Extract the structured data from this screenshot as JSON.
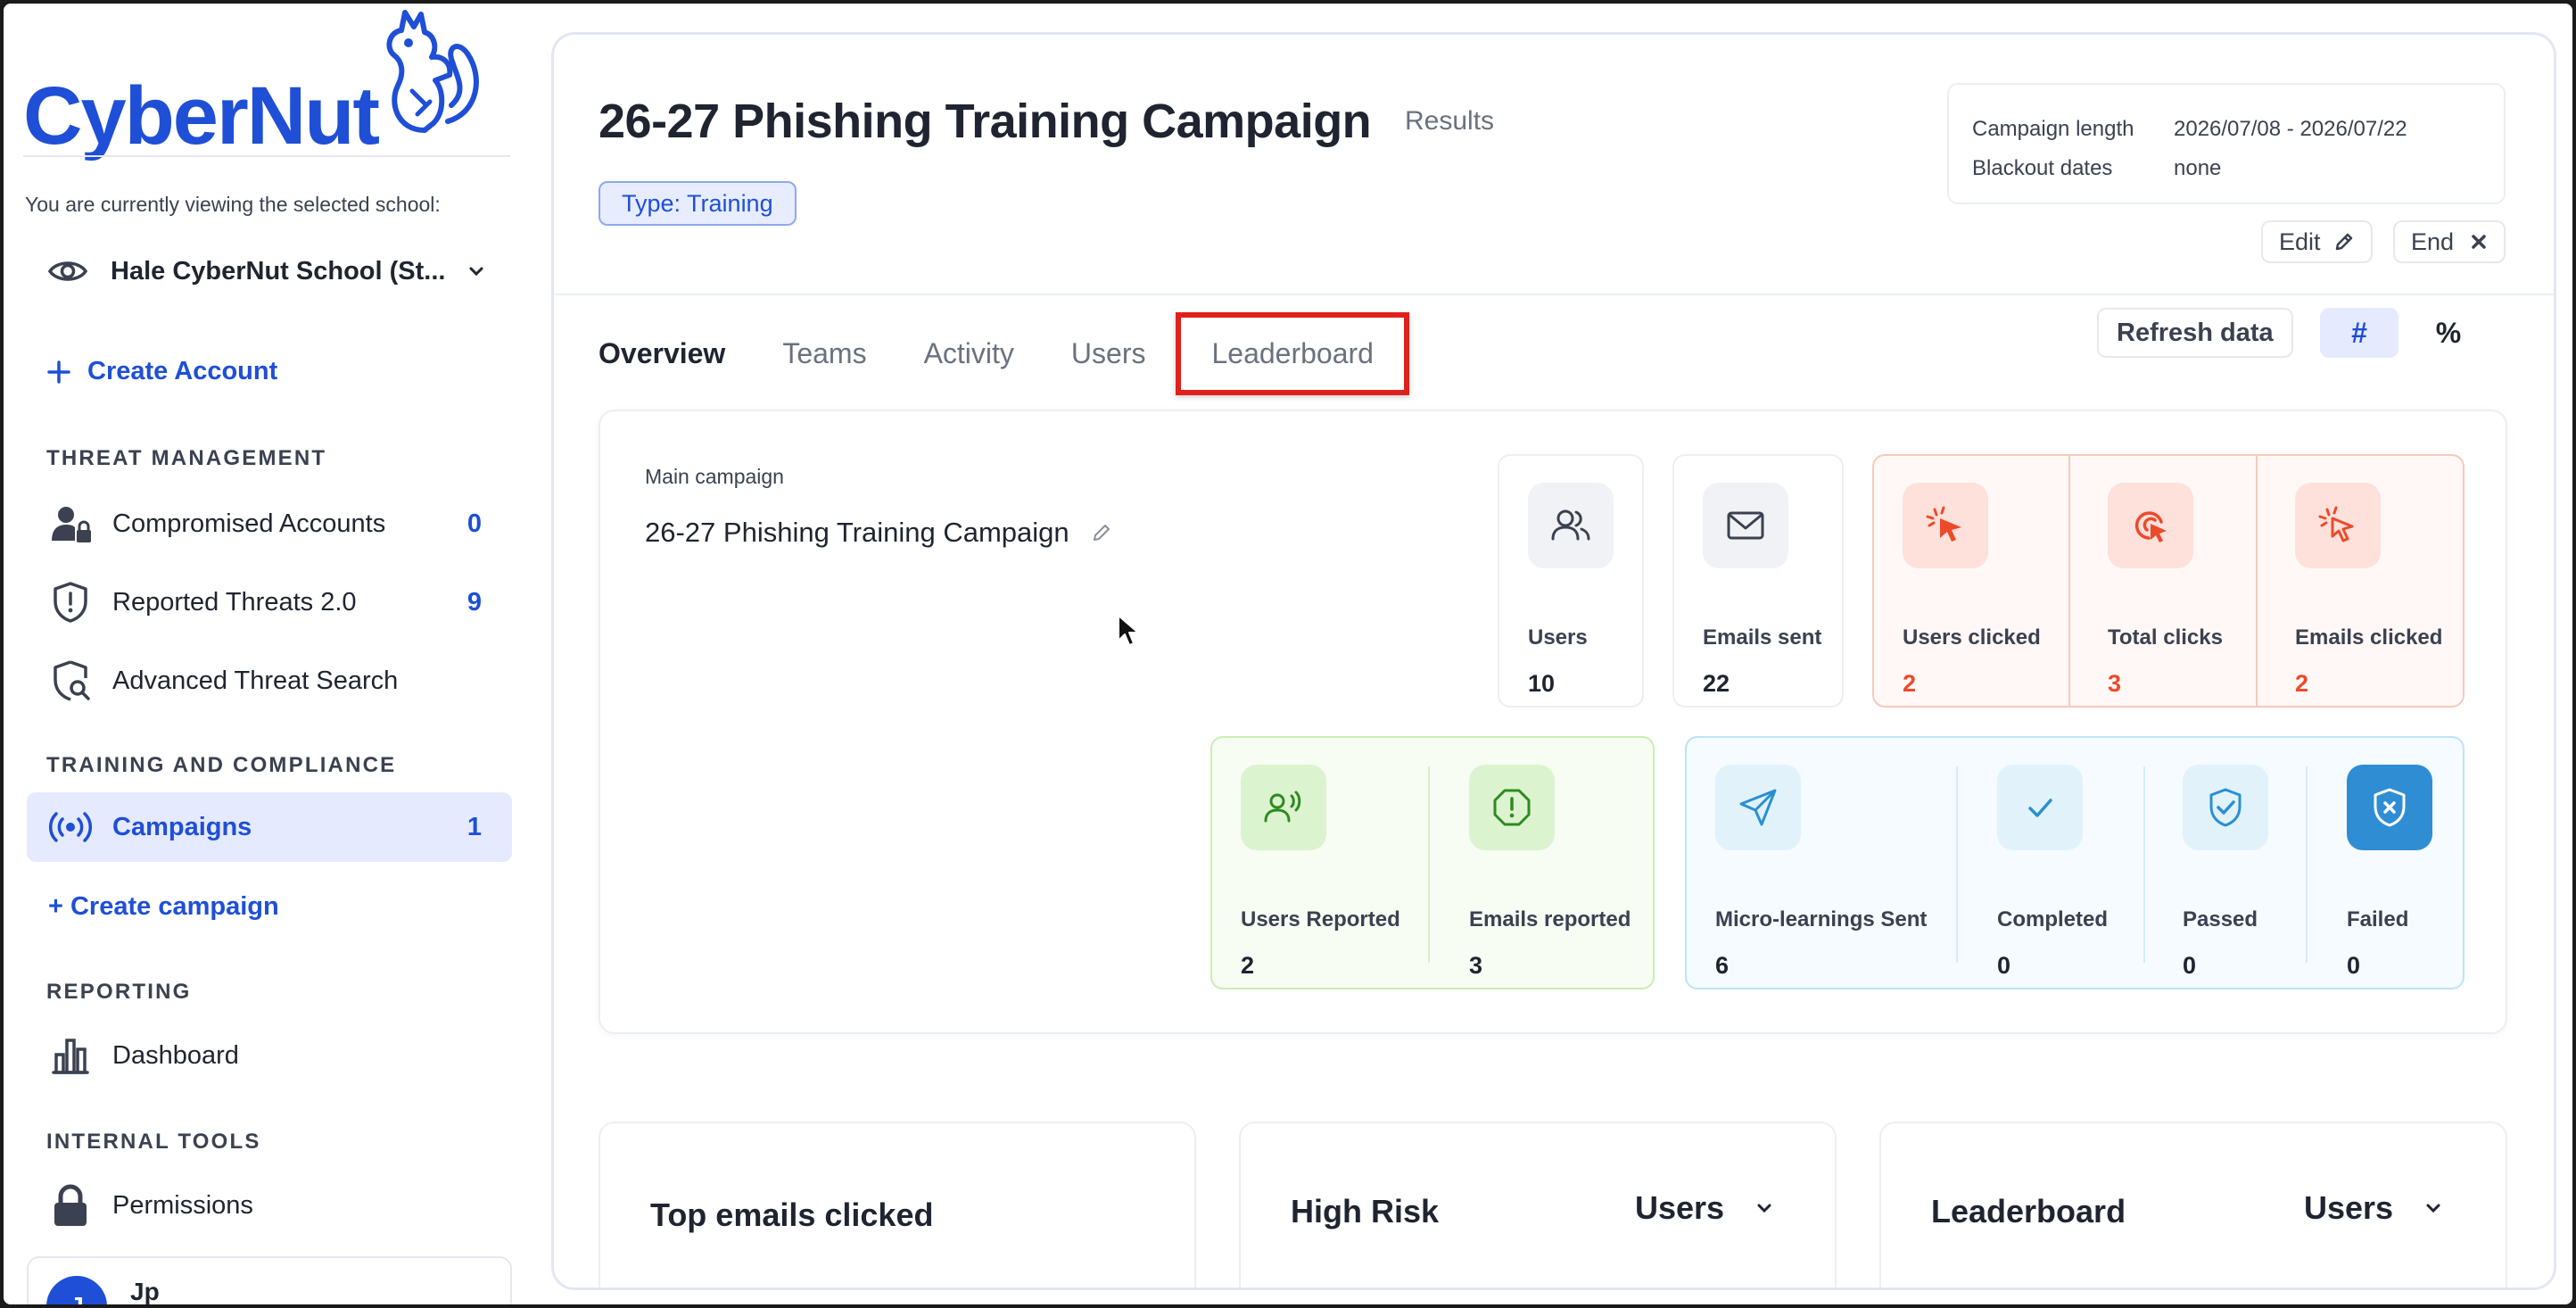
{
  "app": {
    "logo_text": "CyberNut",
    "colors": {
      "brand": "#1e4fd6",
      "alert": "#ec4a2b",
      "highlight": "#e0201b"
    }
  },
  "sidebar": {
    "viewing_label": "You are currently viewing the selected school:",
    "school_name": "Hale CyberNut School (St...",
    "create_account": "Create Account",
    "sections": {
      "threat": "THREAT MANAGEMENT",
      "training": "TRAINING AND COMPLIANCE",
      "reporting": "REPORTING",
      "internal": "INTERNAL TOOLS"
    },
    "items": {
      "compromised": {
        "label": "Compromised Accounts",
        "count": "0",
        "icon": "user-lock-icon"
      },
      "reported": {
        "label": "Reported Threats 2.0",
        "count": "9",
        "icon": "shield-alert-icon"
      },
      "advanced": {
        "label": "Advanced Threat Search",
        "icon": "shield-search-icon"
      },
      "campaigns": {
        "label": "Campaigns",
        "count": "1",
        "icon": "broadcast-icon"
      },
      "dashboard": {
        "label": "Dashboard",
        "icon": "bar-chart-icon"
      },
      "permissions": {
        "label": "Permissions",
        "icon": "lock-icon"
      }
    },
    "create_campaign": "+ Create campaign",
    "user": {
      "name": "Jp",
      "initial": "J"
    }
  },
  "header": {
    "title": "26-27 Phishing Training Campaign",
    "subtitle": "Results",
    "type_badge": "Type: Training",
    "campaign_length_key": "Campaign length",
    "campaign_length_value": "2026/07/08 - 2026/07/22",
    "blackout_key": "Blackout dates",
    "blackout_value": "none",
    "edit_label": "Edit",
    "end_label": "End"
  },
  "tabs": [
    "Overview",
    "Teams",
    "Activity",
    "Users",
    "Leaderboard"
  ],
  "toolbar": {
    "refresh": "Refresh data",
    "hash": "#",
    "percent": "%"
  },
  "summary": {
    "main_campaign_label": "Main campaign",
    "main_campaign_name": "26-27 Phishing Training Campaign",
    "users": {
      "label": "Users",
      "value": "10"
    },
    "emails_sent": {
      "label": "Emails sent",
      "value": "22"
    },
    "users_clicked": {
      "label": "Users clicked",
      "value": "2"
    },
    "total_clicks": {
      "label": "Total clicks",
      "value": "3"
    },
    "emails_clicked": {
      "label": "Emails clicked",
      "value": "2"
    },
    "users_reported": {
      "label": "Users Reported",
      "value": "2"
    },
    "emails_reported": {
      "label": "Emails reported",
      "value": "3"
    },
    "micro_sent": {
      "label": "Micro-learnings Sent",
      "value": "6"
    },
    "completed": {
      "label": "Completed",
      "value": "0"
    },
    "passed": {
      "label": "Passed",
      "value": "0"
    },
    "failed": {
      "label": "Failed",
      "value": "0"
    }
  },
  "bottom": {
    "top_emails": "Top emails clicked",
    "high_risk": "High Risk",
    "high_risk_select": "Users",
    "leaderboard": "Leaderboard",
    "leaderboard_select": "Users"
  }
}
